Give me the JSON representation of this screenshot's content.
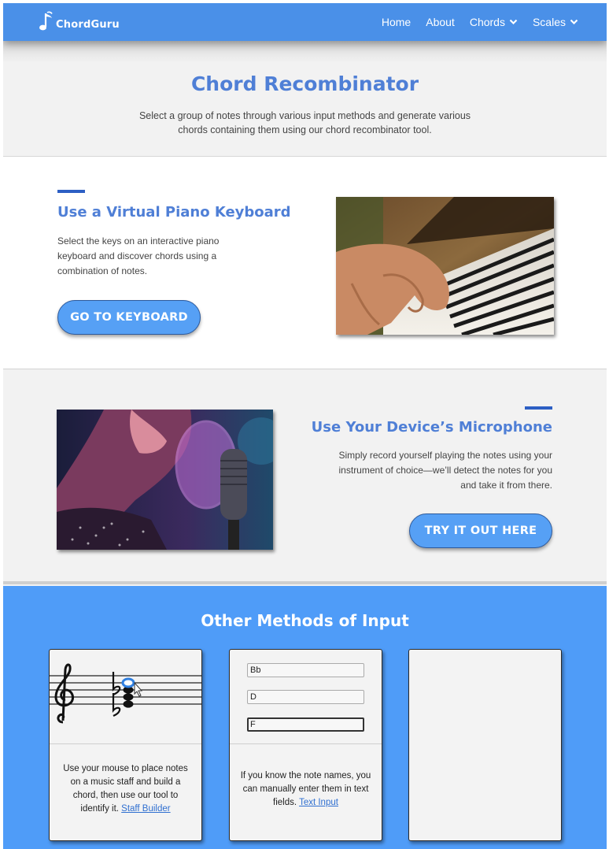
{
  "nav": {
    "brand": "ChordGuru",
    "links": [
      {
        "label": "Home"
      },
      {
        "label": "About"
      },
      {
        "label": "Chords"
      },
      {
        "label": "Scales"
      }
    ]
  },
  "hero": {
    "title": "Chord Recombinator",
    "description": "Select a group of notes through various input methods and generate various chords containing them using our chord recombinator tool."
  },
  "keyboard_section": {
    "title": "Use a Virtual Piano Keyboard",
    "description": "Select the keys on an interactive piano keyboard and discover chords using a combination of notes.",
    "button": "GO TO KEYBOARD"
  },
  "mic_section": {
    "title": "Use Your Device’s Microphone",
    "description": "Simply record yourself playing the notes using your instrument of choice—we’ll detect the notes for you and take it from there.",
    "button": "TRY IT OUT HERE"
  },
  "other_methods": {
    "title": "Other Methods of Input",
    "staff_card": {
      "text": "Use your mouse to place notes on a music staff and build a chord, then use our tool to identify it.",
      "link": "Staff Builder"
    },
    "text_card": {
      "fields": [
        "Bb",
        "D",
        "F"
      ],
      "text": "If you know the note names, you can manually enter them in text fields.",
      "link": "Text Input"
    }
  },
  "colors": {
    "nav": "#4a90e8",
    "accent_text": "#4f7fd6",
    "button": "#56a0f5",
    "other_bg": "#4f9cf8"
  }
}
